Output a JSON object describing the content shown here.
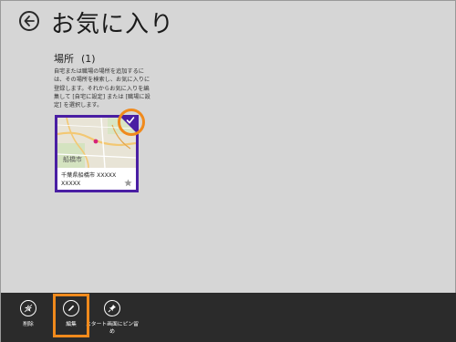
{
  "page": {
    "title": "お気に入り"
  },
  "section": {
    "title": "場所",
    "count": "(1)",
    "help_text": "自宅または職場の場所を追加するには、その場所を検索し、お気に入りに登録します。それからお気に入りを編集して [自宅に設定] または [職場に設定] を選択します。"
  },
  "card": {
    "title": "千葉県船橋市 XXXXX XXXXX",
    "map_label": "船橋市",
    "selected": true
  },
  "app_bar": {
    "delete_label": "削除",
    "edit_label": "編集",
    "pin_label": "スタート画面にピン留め"
  },
  "colors": {
    "accent": "#4a1fa3",
    "highlight": "#f08a1c",
    "app_bar": "#2b2b2b",
    "background": "#d6d6d6"
  }
}
